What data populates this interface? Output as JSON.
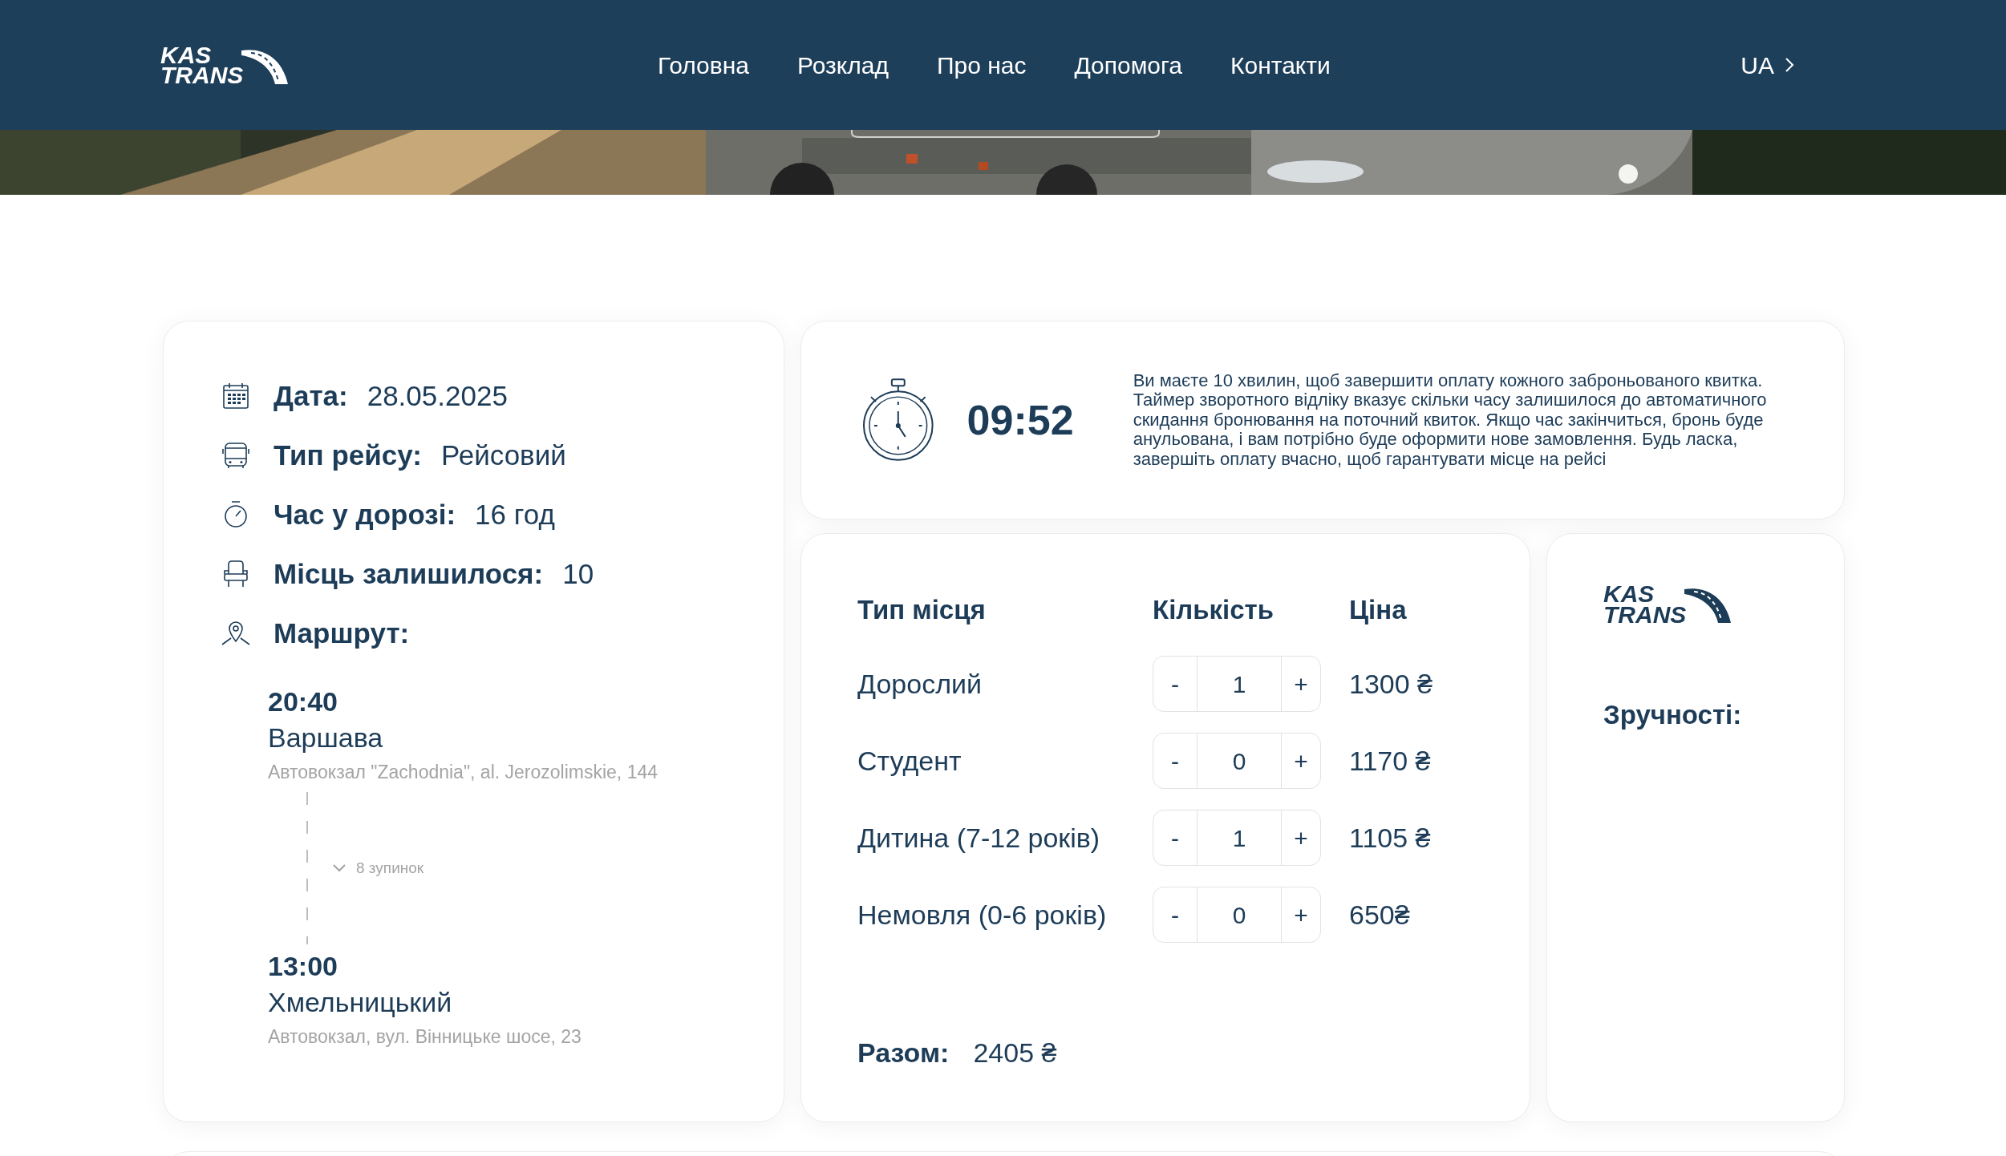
{
  "header": {
    "logo": {
      "line_1": "KAS",
      "line_2": "TRANS"
    },
    "nav": [
      {
        "label": "Головна"
      },
      {
        "label": "Розклад"
      },
      {
        "label": "Про нас"
      },
      {
        "label": "Допомога"
      },
      {
        "label": "Контакти"
      }
    ],
    "language": "UA"
  },
  "trip_info": {
    "items": [
      {
        "kind": "calendar",
        "label": "Дата:",
        "value": "28.05.2025"
      },
      {
        "kind": "bus",
        "label": "Тип рейсу:",
        "value": "Рейсовий"
      },
      {
        "kind": "stopwatch",
        "label": "Час у дорозі:",
        "value": "16 год"
      },
      {
        "kind": "seat",
        "label": "Місць залишилося:",
        "value": "10"
      },
      {
        "kind": "pin",
        "label": "Маршрут:"
      }
    ],
    "route": {
      "departure": {
        "time": "20:40",
        "city": "Варшава",
        "station": "Автовокзал \"Zachodnia\", al. Jerozolimskie, 144"
      },
      "stops": "8 зупинок",
      "arrival": {
        "time": "13:00",
        "city": "Хмельницький",
        "station": "Автовокзал, вул. Вінницьке шосе, 23"
      }
    }
  },
  "timer": {
    "time": "09:52",
    "message": "Ви маєте 10 хвилин, щоб завершити оплату кожного заброньованого квитка. Таймер зворотного відліку вказує скільки часу залишилося до автоматичного скидання бронювання на поточний квиток. Якщо час закінчиться, бронь буде анульована, і вам потрібно буде оформити нове замовлення. Будь ласка, завершіть оплату вчасно, щоб гарантувати місце на рейсі"
  },
  "tickets": {
    "columns": [
      "Тип місця",
      "Кількість",
      "Ціна"
    ],
    "rows": [
      {
        "type": "Дорослий",
        "minus": "-",
        "quantity": "1",
        "plus": "+",
        "price": "1300 ₴"
      },
      {
        "type": "Студент",
        "minus": "-",
        "quantity": "0",
        "plus": "+",
        "price": "1170 ₴"
      },
      {
        "type": "Дитина (7-12 років)",
        "minus": "-",
        "quantity": "1",
        "plus": "+",
        "price": "1105 ₴"
      },
      {
        "type": "Немовля (0-6 років)",
        "minus": "-",
        "quantity": "0",
        "plus": "+",
        "price": "650₴"
      }
    ],
    "total_label": "Разом:",
    "total": "2405 ₴"
  },
  "amenities": {
    "logo": {
      "line_1": "KAS",
      "line_2": "TRANS"
    },
    "title": "Зручності:"
  }
}
